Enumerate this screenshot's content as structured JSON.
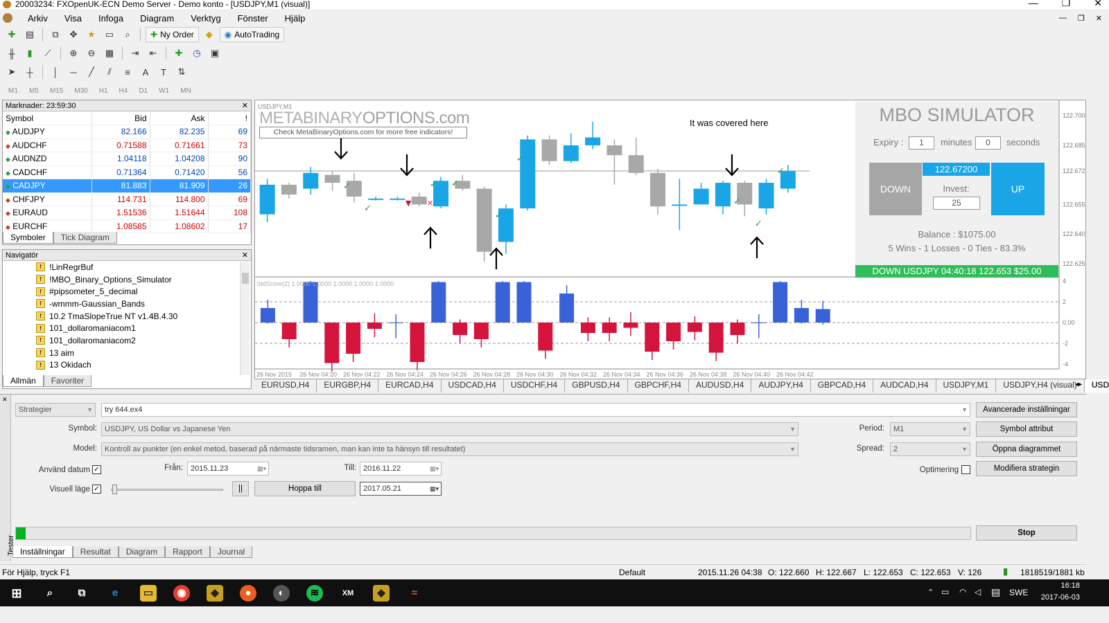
{
  "window": {
    "title": "20003234: FXOpenUK-ECN Demo Server - Demo konto - [USDJPY,M1 (visual)]"
  },
  "menu": [
    "Arkiv",
    "Visa",
    "Infoga",
    "Diagram",
    "Verktyg",
    "Fönster",
    "Hjälp"
  ],
  "toolbar": {
    "new_order": "Ny Order",
    "autotrading": "AutoTrading",
    "timeframes": [
      "M1",
      "M5",
      "M15",
      "M30",
      "H1",
      "H4",
      "D1",
      "W1",
      "MN"
    ]
  },
  "market_watch": {
    "title": "Marknader: 23:59:30",
    "headers": {
      "symbol": "Symbol",
      "bid": "Bid",
      "ask": "Ask",
      "spread": "!"
    },
    "rows": [
      {
        "symbol": "AUDJPY",
        "bid": "82.166",
        "ask": "82.235",
        "spread": "69",
        "dir": "up"
      },
      {
        "symbol": "AUDCHF",
        "bid": "0.71588",
        "ask": "0.71661",
        "spread": "73",
        "dir": "down"
      },
      {
        "symbol": "AUDNZD",
        "bid": "1.04118",
        "ask": "1.04208",
        "spread": "90",
        "dir": "up"
      },
      {
        "symbol": "CADCHF",
        "bid": "0.71364",
        "ask": "0.71420",
        "spread": "56",
        "dir": "up"
      },
      {
        "symbol": "CADJPY",
        "bid": "81.883",
        "ask": "81.909",
        "spread": "26",
        "dir": "up"
      },
      {
        "symbol": "CHFJPY",
        "bid": "114.731",
        "ask": "114.800",
        "spread": "69",
        "dir": "down"
      },
      {
        "symbol": "EURAUD",
        "bid": "1.51536",
        "ask": "1.51644",
        "spread": "108",
        "dir": "down"
      },
      {
        "symbol": "EURCHF",
        "bid": "1.08585",
        "ask": "1.08602",
        "spread": "17",
        "dir": "down"
      }
    ],
    "tabs": [
      "Symboler",
      "Tick Diagram"
    ]
  },
  "navigator": {
    "title": "Navigatör",
    "items": [
      "!LinRegrBuf",
      "!MBO_Binary_Options_Simulator",
      "#pipsometer_5_decimal",
      "-wmmm-Gaussian_Bands",
      "10.2 TmaSlopeTrue NT v1.4B.4.30",
      "101_dollaromaniacom1",
      "101_dollaromaniacom2",
      "13 aim",
      "13 Okidach"
    ],
    "tabs": [
      "Allmän",
      "Favoriter"
    ]
  },
  "chart": {
    "symbol_label": "USDJPY,M1",
    "watermark_a": "METABINARY",
    "watermark_b": "OPTIONS.com",
    "watermark_link": "Check MetaBinaryOptions.com for more free indicators!",
    "annotation": "It was covered here",
    "indicator_label": "StdScore(2) 1.0000 1.0000 1.0000 1.0000 1.0000",
    "price_ticks": [
      "122.700",
      "122.685",
      "122.672",
      "122.655",
      "122.640",
      "122.625"
    ],
    "osc_ticks": [
      "4",
      "2",
      "0.00",
      "-2",
      "-4"
    ],
    "time_ticks": [
      "26 Nov 2015",
      "26 Nov 04:20",
      "26 Nov 04:22",
      "26 Nov 04:24",
      "26 Nov 04:26",
      "26 Nov 04:28",
      "26 Nov 04:30",
      "26 Nov 04:32",
      "26 Nov 04:34",
      "26 Nov 04:36",
      "26 Nov 04:38",
      "26 Nov 04:40",
      "26 Nov 04:42"
    ],
    "colors": {
      "bull": "#1aa6e6",
      "bear": "#a8a8a8",
      "osc_up": "#3a62d8",
      "osc_down": "#d4143c",
      "panel_green": "#2ebd59"
    }
  },
  "chart_data": {
    "type": "candlestick",
    "candles": [
      {
        "o": 122.65,
        "c": 122.665,
        "h": 122.668,
        "l": 122.646
      },
      {
        "o": 122.665,
        "c": 122.66,
        "h": 122.666,
        "l": 122.658
      },
      {
        "o": 122.663,
        "c": 122.671,
        "h": 122.674,
        "l": 122.66
      },
      {
        "o": 122.67,
        "c": 122.666,
        "h": 122.672,
        "l": 122.662
      },
      {
        "o": 122.667,
        "c": 122.659,
        "h": 122.671,
        "l": 122.656
      },
      {
        "o": 122.658,
        "c": 122.658,
        "h": 122.659,
        "l": 122.657
      },
      {
        "o": 122.658,
        "c": 122.658,
        "h": 122.659,
        "l": 122.657
      },
      {
        "o": 122.659,
        "c": 122.655,
        "h": 122.661,
        "l": 122.654
      },
      {
        "o": 122.654,
        "c": 122.667,
        "h": 122.669,
        "l": 122.653
      },
      {
        "o": 122.667,
        "c": 122.663,
        "h": 122.67,
        "l": 122.662
      },
      {
        "o": 122.663,
        "c": 122.631,
        "h": 122.664,
        "l": 122.626
      },
      {
        "o": 122.636,
        "c": 122.653,
        "h": 122.655,
        "l": 122.63
      },
      {
        "o": 122.653,
        "c": 122.688,
        "h": 122.69,
        "l": 122.652
      },
      {
        "o": 122.688,
        "c": 122.677,
        "h": 122.69,
        "l": 122.675
      },
      {
        "o": 122.677,
        "c": 122.685,
        "h": 122.691,
        "l": 122.676
      },
      {
        "o": 122.685,
        "c": 122.689,
        "h": 122.697,
        "l": 122.683
      },
      {
        "o": 122.685,
        "c": 122.68,
        "h": 122.688,
        "l": 122.665
      },
      {
        "o": 122.68,
        "c": 122.671,
        "h": 122.689,
        "l": 122.67
      },
      {
        "o": 122.671,
        "c": 122.654,
        "h": 122.673,
        "l": 122.65
      },
      {
        "o": 122.655,
        "c": 122.655,
        "h": 122.668,
        "l": 122.642
      },
      {
        "o": 122.655,
        "c": 122.663,
        "h": 122.666,
        "l": 122.655
      },
      {
        "o": 122.654,
        "c": 122.666,
        "h": 122.667,
        "l": 122.65
      },
      {
        "o": 122.666,
        "c": 122.655,
        "h": 122.667,
        "l": 122.649
      },
      {
        "o": 122.653,
        "c": 122.666,
        "h": 122.668,
        "l": 122.65
      },
      {
        "o": 122.663,
        "c": 122.672,
        "h": 122.675,
        "l": 122.661
      }
    ],
    "oscillator": [
      1.4,
      -1.6,
      3.9,
      -3.9,
      -3.0,
      -0.6,
      0.0,
      -3.8,
      3.9,
      -1.2,
      -1.6,
      3.9,
      3.9,
      -2.7,
      2.8,
      -1.0,
      -1.0,
      -0.5,
      -2.8,
      -1.8,
      -0.9,
      -2.9,
      -1.2,
      0.0,
      3.9,
      1.4,
      1.3
    ],
    "price_range": [
      122.62,
      122.705
    ],
    "osc_range": [
      -4.2,
      4.2
    ]
  },
  "mbo": {
    "title": "MBO SIMULATOR",
    "expiry_label": "Expiry :",
    "expiry_minutes": "1",
    "minutes_label": "minutes",
    "expiry_seconds": "0",
    "seconds_label": "seconds",
    "down_label": "DOWN",
    "up_label": "UP",
    "price": "122.67200",
    "invest_label": "Invest:",
    "invest_value": "25",
    "balance": "Balance : $1075.00",
    "stats": "5 Wins - 1 Losses - 0 Ties - 83.3%",
    "last_trade": "DOWN USDJPY 04:40:18 122.653 $25.00"
  },
  "chart_tabs": [
    "EURUSD,H4",
    "EURGBP,H4",
    "EURCAD,H4",
    "USDCAD,H4",
    "USDCHF,H4",
    "GBPUSD,H4",
    "GBPCHF,H4",
    "AUDUSD,H4",
    "AUDJPY,H4",
    "GBPCAD,H4",
    "AUDCAD,H4",
    "USDJPY,M1",
    "USDJPY,H4 (visual)",
    "USDJ"
  ],
  "tester": {
    "type_value": "Strategier",
    "ea_value": "try 644.ex4",
    "adv_settings": "Avancerade inställningar",
    "symbol_label": "Symbol:",
    "symbol_value": "USDJPY, US Dollar vs Japanese Yen",
    "period_label": "Period:",
    "period_value": "M1",
    "symbol_attr": "Symbol attribut",
    "model_label": "Model:",
    "model_value": "Kontroll av punkter (en enkel metod, baserad på närmaste tidsramen, man kan inte ta hänsyn till resultatet)",
    "spread_label": "Spread:",
    "spread_value": "2",
    "open_chart": "Öppna diagrammet",
    "use_date_label": "Använd datum",
    "from_label": "Från:",
    "from_value": "2015.11.23",
    "to_label": "Till:",
    "to_value": "2016.11.22",
    "optimize_label": "Optimering",
    "modify_strategy": "Modifiera strategin",
    "visual_label": "Visuell läge",
    "pause": "||",
    "skip_to": "Hoppa till",
    "skip_date": "2017.05.21",
    "stop": "Stop",
    "progress": 0.01,
    "side_label": "Tester",
    "tabs": [
      "Inställningar",
      "Resultat",
      "Diagram",
      "Rapport",
      "Journal"
    ]
  },
  "statusbar": {
    "help": "För Hjälp, tryck F1",
    "profile": "Default",
    "time": "2015.11.26 04:38",
    "open": "O: 122.660",
    "high": "H: 122.667",
    "low": "L: 122.653",
    "close": "C: 122.653",
    "volume": "V: 126",
    "traffic": "1818519/1881 kb"
  },
  "taskbar": {
    "lang": "SWE",
    "time": "16:18",
    "date": "2017-06-03"
  }
}
